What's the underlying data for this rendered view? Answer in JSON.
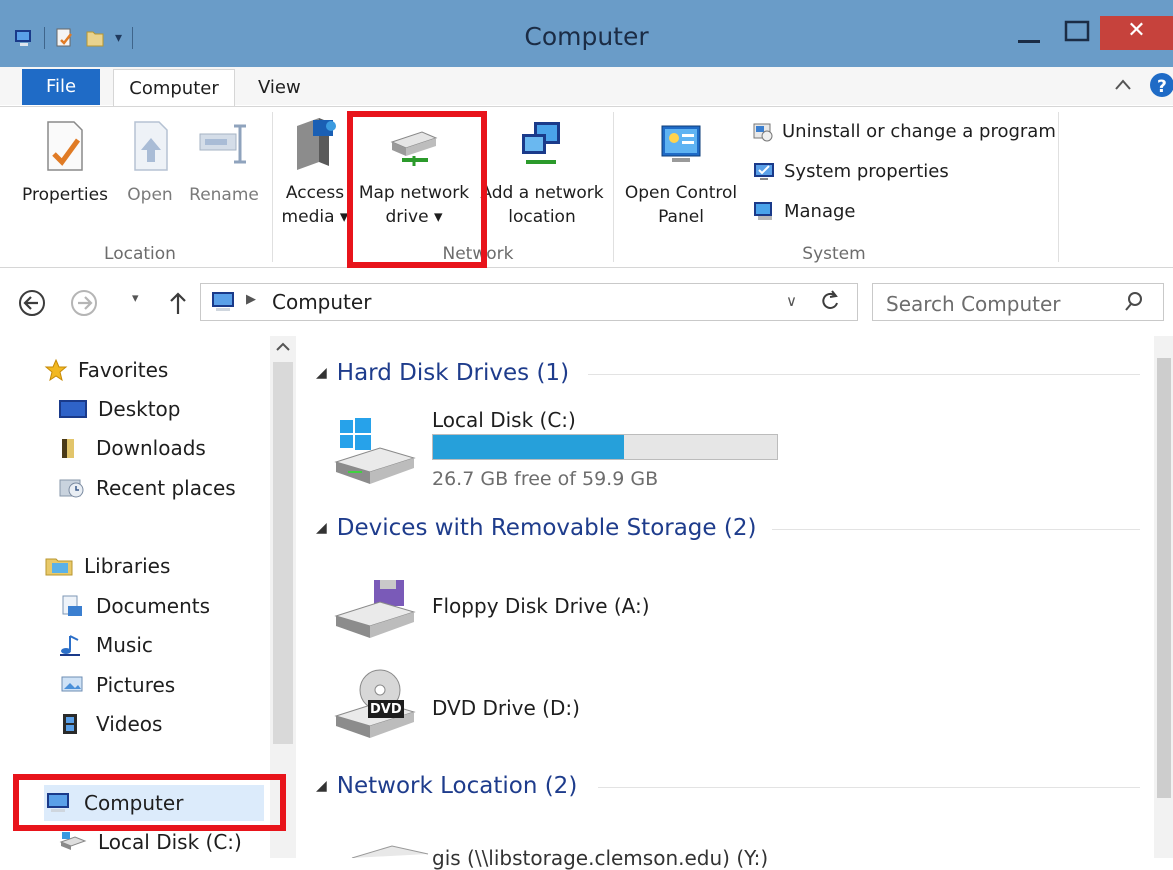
{
  "window": {
    "title": "Computer",
    "close_glyph": "✕"
  },
  "tabs": {
    "file": "File",
    "computer": "Computer",
    "view": "View"
  },
  "ribbon": {
    "location": {
      "group_label": "Location",
      "properties": "Properties",
      "open": "Open",
      "rename": "Rename"
    },
    "network": {
      "group_label": "Network",
      "access_media_line1": "Access",
      "access_media_line2": "media ▾",
      "map_drive_line1": "Map network",
      "map_drive_line2": "drive ▾",
      "add_location_line1": "Add a network",
      "add_location_line2": "location"
    },
    "system": {
      "group_label": "System",
      "control_panel_line1": "Open Control",
      "control_panel_line2": "Panel",
      "uninstall": "Uninstall or change a program",
      "properties": "System properties",
      "manage": "Manage"
    }
  },
  "address": {
    "crumb": "Computer",
    "search_placeholder": "Search Computer"
  },
  "nav": {
    "favorites": "Favorites",
    "desktop": "Desktop",
    "downloads": "Downloads",
    "recent": "Recent places",
    "libraries": "Libraries",
    "documents": "Documents",
    "music": "Music",
    "pictures": "Pictures",
    "videos": "Videos",
    "computer": "Computer",
    "local_disk": "Local Disk (C:)"
  },
  "content": {
    "groups": {
      "hdd": "Hard Disk Drives (1)",
      "removable": "Devices with Removable Storage (2)",
      "network": "Network Location (2)"
    },
    "drives": {
      "c_name": "Local Disk (C:)",
      "c_free": "26.7 GB free of 59.9 GB",
      "c_used_fraction": 0.554,
      "floppy": "Floppy Disk Drive (A:)",
      "dvd": "DVD Drive (D:)",
      "dvd_badge": "DVD",
      "net1": "gis (\\\\libstorage.clemson.edu) (Y:)"
    }
  },
  "colors": {
    "titlebar": "#6a9cc8",
    "file_tab": "#1f6bc6",
    "close": "#c6423c",
    "accent_text": "#1e3c8c",
    "highlight": "#e8141b",
    "usage_bar": "#26a0da"
  }
}
